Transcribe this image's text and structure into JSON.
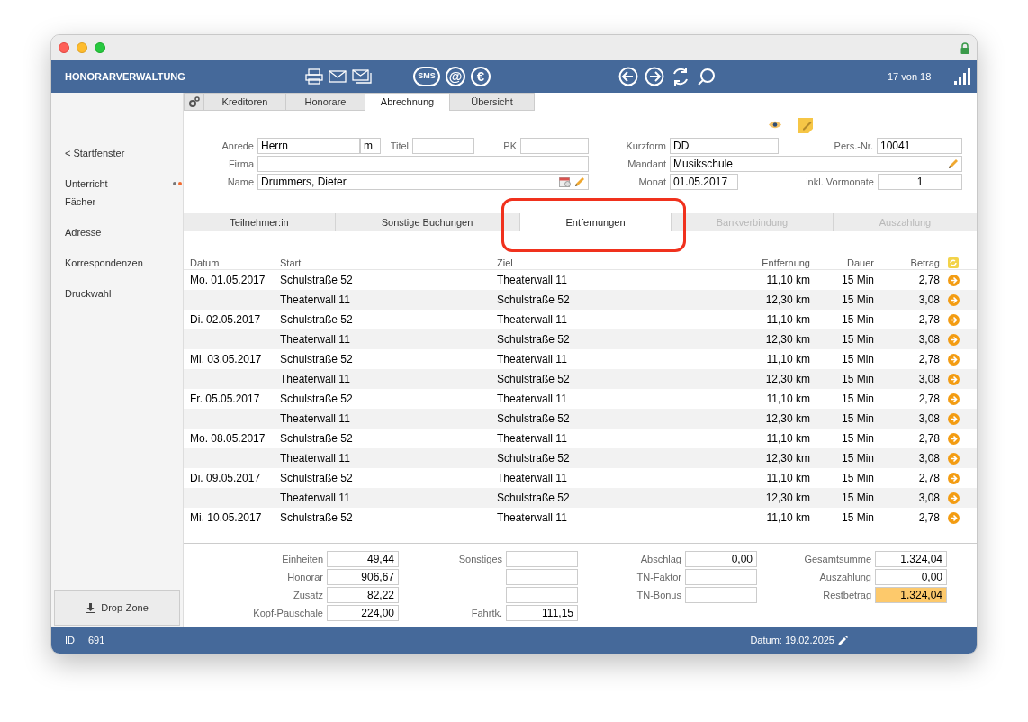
{
  "header": {
    "title": "HONORARVERWALTUNG",
    "toolbar_glyphs": [
      "SMS",
      "@",
      "€"
    ],
    "record_counter": "17 von 18"
  },
  "sidebar": {
    "items": [
      {
        "label": "< Startfenster",
        "kind": "link"
      },
      {
        "label": "Unterricht",
        "kind": "dots"
      },
      {
        "label": "Fächer",
        "kind": "plain"
      },
      {
        "label": "Adresse",
        "kind": "link"
      },
      {
        "label": "Korrespondenzen",
        "kind": "link"
      },
      {
        "label": "Druckwahl",
        "kind": "link"
      }
    ],
    "drop_zone": "Drop-Zone"
  },
  "tabs": [
    {
      "label": "Kreditoren",
      "selected": false
    },
    {
      "label": "Honorare",
      "selected": false
    },
    {
      "label": "Abrechnung",
      "selected": true
    },
    {
      "label": "Übersicht",
      "selected": false
    }
  ],
  "form": {
    "anrede": {
      "label": "Anrede",
      "value": "Herrn"
    },
    "geschlecht": {
      "value": "m"
    },
    "titel": {
      "label": "Titel"
    },
    "pk": {
      "label": "PK"
    },
    "firma": {
      "label": "Firma"
    },
    "name": {
      "label": "Name",
      "value": "Drummers, Dieter"
    },
    "kurzform": {
      "label": "Kurzform",
      "value": "DD"
    },
    "pers_nr": {
      "label": "Pers.-Nr.",
      "value": "10041"
    },
    "mandant": {
      "label": "Mandant",
      "value": "Musikschule"
    },
    "monat": {
      "label": "Monat",
      "value": "01.05.2017"
    },
    "vormonate": {
      "label": "inkl. Vormonate",
      "value": "1"
    }
  },
  "sub_tabs": [
    {
      "label": "Teilnehmer:in",
      "selected": false,
      "disabled": false
    },
    {
      "label": "Sonstige Buchungen",
      "selected": false,
      "disabled": false
    },
    {
      "label": "Entfernungen",
      "selected": true,
      "disabled": false
    },
    {
      "label": "Bankverbindung",
      "selected": false,
      "disabled": true
    },
    {
      "label": "Auszahlung",
      "selected": false,
      "disabled": true
    }
  ],
  "table": {
    "columns": [
      "Datum",
      "Start",
      "Ziel",
      "Entfernung",
      "Dauer",
      "Betrag"
    ],
    "rows": [
      {
        "datum": "Mo. 01.05.2017",
        "start": "Schulstraße 52",
        "ziel": "Theaterwall 11",
        "entfernung": "11,10 km",
        "dauer": "15 Min",
        "betrag": "2,78"
      },
      {
        "start": "Theaterwall 11",
        "ziel": "Schulstraße 52",
        "entfernung": "12,30 km",
        "dauer": "15 Min",
        "betrag": "3,08"
      },
      {
        "datum": "Di. 02.05.2017",
        "start": "Schulstraße 52",
        "ziel": "Theaterwall 11",
        "entfernung": "11,10 km",
        "dauer": "15 Min",
        "betrag": "2,78"
      },
      {
        "start": "Theaterwall 11",
        "ziel": "Schulstraße 52",
        "entfernung": "12,30 km",
        "dauer": "15 Min",
        "betrag": "3,08"
      },
      {
        "datum": "Mi. 03.05.2017",
        "start": "Schulstraße 52",
        "ziel": "Theaterwall 11",
        "entfernung": "11,10 km",
        "dauer": "15 Min",
        "betrag": "2,78"
      },
      {
        "start": "Theaterwall 11",
        "ziel": "Schulstraße 52",
        "entfernung": "12,30 km",
        "dauer": "15 Min",
        "betrag": "3,08"
      },
      {
        "datum": "Fr. 05.05.2017",
        "start": "Schulstraße 52",
        "ziel": "Theaterwall 11",
        "entfernung": "11,10 km",
        "dauer": "15 Min",
        "betrag": "2,78"
      },
      {
        "start": "Theaterwall 11",
        "ziel": "Schulstraße 52",
        "entfernung": "12,30 km",
        "dauer": "15 Min",
        "betrag": "3,08"
      },
      {
        "datum": "Mo. 08.05.2017",
        "start": "Schulstraße 52",
        "ziel": "Theaterwall 11",
        "entfernung": "11,10 km",
        "dauer": "15 Min",
        "betrag": "2,78"
      },
      {
        "start": "Theaterwall 11",
        "ziel": "Schulstraße 52",
        "entfernung": "12,30 km",
        "dauer": "15 Min",
        "betrag": "3,08"
      },
      {
        "datum": "Di. 09.05.2017",
        "start": "Schulstraße 52",
        "ziel": "Theaterwall 11",
        "entfernung": "11,10 km",
        "dauer": "15 Min",
        "betrag": "2,78"
      },
      {
        "start": "Theaterwall 11",
        "ziel": "Schulstraße 52",
        "entfernung": "12,30 km",
        "dauer": "15 Min",
        "betrag": "3,08"
      },
      {
        "datum": "Mi. 10.05.2017",
        "start": "Schulstraße 52",
        "ziel": "Theaterwall 11",
        "entfernung": "11,10 km",
        "dauer": "15 Min",
        "betrag": "2,78"
      }
    ]
  },
  "summary": [
    [
      {
        "kind": "labeled",
        "label": "Einheiten",
        "value": "49,44"
      },
      {
        "kind": "labeled",
        "label": "Honorar",
        "value": "906,67"
      },
      {
        "kind": "labeled",
        "label": "Zusatz",
        "value": "82,22"
      },
      {
        "kind": "labeled",
        "label": "Kopf-Pauschale",
        "value": "224,00"
      }
    ],
    [
      {
        "kind": "labeled",
        "label": "Sonstiges"
      },
      {
        "kind": "unlabeled"
      },
      {
        "kind": "unlabeled"
      },
      {
        "kind": "labeled",
        "label": "Fahrtk.",
        "value": "111,15"
      }
    ],
    [
      {
        "kind": "labeled",
        "label": "Abschlag",
        "value": "0,00"
      },
      {
        "kind": "labeled",
        "label": "TN-Faktor"
      },
      {
        "kind": "labeled",
        "label": "TN-Bonus"
      }
    ],
    [
      {
        "kind": "labeled",
        "label": "Gesamtsumme",
        "value": "1.324,04"
      },
      {
        "kind": "labeled",
        "label": "Auszahlung",
        "value": "0,00"
      },
      {
        "kind": "labeled",
        "label": "Restbetrag",
        "value": "1.324,04",
        "highlighted": true
      }
    ]
  ],
  "footer": {
    "id_label": "ID",
    "id_value": "691",
    "date": "Datum: 19.02.2025"
  }
}
